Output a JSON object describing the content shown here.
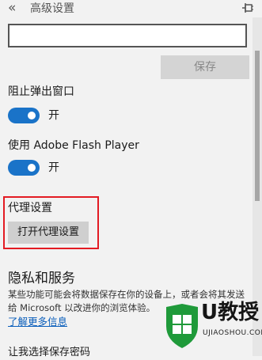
{
  "header": {
    "back_icon": "«",
    "title": "高级设置",
    "pin_icon": "pin-icon"
  },
  "save_button_label": "保存",
  "popups": {
    "label": "阻止弹出窗口",
    "state": "开",
    "enabled": true
  },
  "flash": {
    "label": "使用 Adobe Flash Player",
    "state": "开",
    "enabled": true
  },
  "proxy": {
    "label": "代理设置",
    "button_label": "打开代理设置",
    "highlight_color": "#e31b23"
  },
  "privacy": {
    "heading": "隐私和服务",
    "description": "某些功能可能会将数据保存在你的设备上，或者会将其发送给 Microsoft 以改进你的浏览体验。",
    "learn_more": "了解更多信息",
    "next_label": "让我选择保存密码"
  },
  "watermark": {
    "brand": "U教授",
    "url": "UJIAOSHOU.COM"
  },
  "colors": {
    "accent": "#1a73c8",
    "link": "#0a5ebb",
    "background": "#f2f2f2"
  }
}
